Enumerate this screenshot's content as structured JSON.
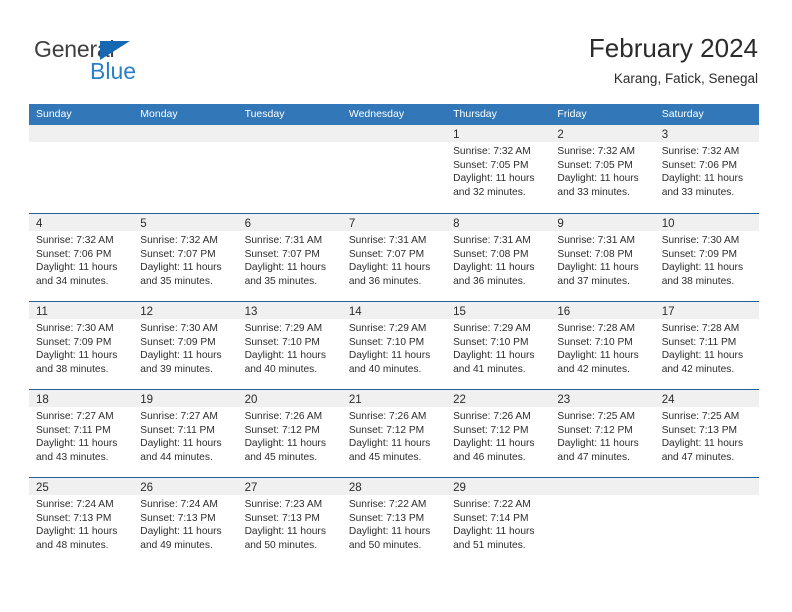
{
  "logo": {
    "word1": "General",
    "word2": "Blue",
    "triangle_color": "#1668b3",
    "word1_color": "#3f3f3f",
    "word2_color": "#2a7fc9"
  },
  "header": {
    "title": "February 2024",
    "subtitle": "Karang, Fatick, Senegal"
  },
  "theme": {
    "header_bg": "#3278b8",
    "header_text": "#ffffff",
    "row_divider": "#245f93",
    "daynum_band": "#f0f0f0",
    "body_text": "#2d2d2d"
  },
  "weekdays": [
    "Sunday",
    "Monday",
    "Tuesday",
    "Wednesday",
    "Thursday",
    "Friday",
    "Saturday"
  ],
  "weeks": [
    [
      {
        "day": "",
        "lines": []
      },
      {
        "day": "",
        "lines": []
      },
      {
        "day": "",
        "lines": []
      },
      {
        "day": "",
        "lines": []
      },
      {
        "day": "1",
        "lines": [
          "Sunrise: 7:32 AM",
          "Sunset: 7:05 PM",
          "Daylight: 11 hours",
          "and 32 minutes."
        ]
      },
      {
        "day": "2",
        "lines": [
          "Sunrise: 7:32 AM",
          "Sunset: 7:05 PM",
          "Daylight: 11 hours",
          "and 33 minutes."
        ]
      },
      {
        "day": "3",
        "lines": [
          "Sunrise: 7:32 AM",
          "Sunset: 7:06 PM",
          "Daylight: 11 hours",
          "and 33 minutes."
        ]
      }
    ],
    [
      {
        "day": "4",
        "lines": [
          "Sunrise: 7:32 AM",
          "Sunset: 7:06 PM",
          "Daylight: 11 hours",
          "and 34 minutes."
        ]
      },
      {
        "day": "5",
        "lines": [
          "Sunrise: 7:32 AM",
          "Sunset: 7:07 PM",
          "Daylight: 11 hours",
          "and 35 minutes."
        ]
      },
      {
        "day": "6",
        "lines": [
          "Sunrise: 7:31 AM",
          "Sunset: 7:07 PM",
          "Daylight: 11 hours",
          "and 35 minutes."
        ]
      },
      {
        "day": "7",
        "lines": [
          "Sunrise: 7:31 AM",
          "Sunset: 7:07 PM",
          "Daylight: 11 hours",
          "and 36 minutes."
        ]
      },
      {
        "day": "8",
        "lines": [
          "Sunrise: 7:31 AM",
          "Sunset: 7:08 PM",
          "Daylight: 11 hours",
          "and 36 minutes."
        ]
      },
      {
        "day": "9",
        "lines": [
          "Sunrise: 7:31 AM",
          "Sunset: 7:08 PM",
          "Daylight: 11 hours",
          "and 37 minutes."
        ]
      },
      {
        "day": "10",
        "lines": [
          "Sunrise: 7:30 AM",
          "Sunset: 7:09 PM",
          "Daylight: 11 hours",
          "and 38 minutes."
        ]
      }
    ],
    [
      {
        "day": "11",
        "lines": [
          "Sunrise: 7:30 AM",
          "Sunset: 7:09 PM",
          "Daylight: 11 hours",
          "and 38 minutes."
        ]
      },
      {
        "day": "12",
        "lines": [
          "Sunrise: 7:30 AM",
          "Sunset: 7:09 PM",
          "Daylight: 11 hours",
          "and 39 minutes."
        ]
      },
      {
        "day": "13",
        "lines": [
          "Sunrise: 7:29 AM",
          "Sunset: 7:10 PM",
          "Daylight: 11 hours",
          "and 40 minutes."
        ]
      },
      {
        "day": "14",
        "lines": [
          "Sunrise: 7:29 AM",
          "Sunset: 7:10 PM",
          "Daylight: 11 hours",
          "and 40 minutes."
        ]
      },
      {
        "day": "15",
        "lines": [
          "Sunrise: 7:29 AM",
          "Sunset: 7:10 PM",
          "Daylight: 11 hours",
          "and 41 minutes."
        ]
      },
      {
        "day": "16",
        "lines": [
          "Sunrise: 7:28 AM",
          "Sunset: 7:10 PM",
          "Daylight: 11 hours",
          "and 42 minutes."
        ]
      },
      {
        "day": "17",
        "lines": [
          "Sunrise: 7:28 AM",
          "Sunset: 7:11 PM",
          "Daylight: 11 hours",
          "and 42 minutes."
        ]
      }
    ],
    [
      {
        "day": "18",
        "lines": [
          "Sunrise: 7:27 AM",
          "Sunset: 7:11 PM",
          "Daylight: 11 hours",
          "and 43 minutes."
        ]
      },
      {
        "day": "19",
        "lines": [
          "Sunrise: 7:27 AM",
          "Sunset: 7:11 PM",
          "Daylight: 11 hours",
          "and 44 minutes."
        ]
      },
      {
        "day": "20",
        "lines": [
          "Sunrise: 7:26 AM",
          "Sunset: 7:12 PM",
          "Daylight: 11 hours",
          "and 45 minutes."
        ]
      },
      {
        "day": "21",
        "lines": [
          "Sunrise: 7:26 AM",
          "Sunset: 7:12 PM",
          "Daylight: 11 hours",
          "and 45 minutes."
        ]
      },
      {
        "day": "22",
        "lines": [
          "Sunrise: 7:26 AM",
          "Sunset: 7:12 PM",
          "Daylight: 11 hours",
          "and 46 minutes."
        ]
      },
      {
        "day": "23",
        "lines": [
          "Sunrise: 7:25 AM",
          "Sunset: 7:12 PM",
          "Daylight: 11 hours",
          "and 47 minutes."
        ]
      },
      {
        "day": "24",
        "lines": [
          "Sunrise: 7:25 AM",
          "Sunset: 7:13 PM",
          "Daylight: 11 hours",
          "and 47 minutes."
        ]
      }
    ],
    [
      {
        "day": "25",
        "lines": [
          "Sunrise: 7:24 AM",
          "Sunset: 7:13 PM",
          "Daylight: 11 hours",
          "and 48 minutes."
        ]
      },
      {
        "day": "26",
        "lines": [
          "Sunrise: 7:24 AM",
          "Sunset: 7:13 PM",
          "Daylight: 11 hours",
          "and 49 minutes."
        ]
      },
      {
        "day": "27",
        "lines": [
          "Sunrise: 7:23 AM",
          "Sunset: 7:13 PM",
          "Daylight: 11 hours",
          "and 50 minutes."
        ]
      },
      {
        "day": "28",
        "lines": [
          "Sunrise: 7:22 AM",
          "Sunset: 7:13 PM",
          "Daylight: 11 hours",
          "and 50 minutes."
        ]
      },
      {
        "day": "29",
        "lines": [
          "Sunrise: 7:22 AM",
          "Sunset: 7:14 PM",
          "Daylight: 11 hours",
          "and 51 minutes."
        ]
      },
      {
        "day": "",
        "lines": []
      },
      {
        "day": "",
        "lines": []
      }
    ]
  ]
}
